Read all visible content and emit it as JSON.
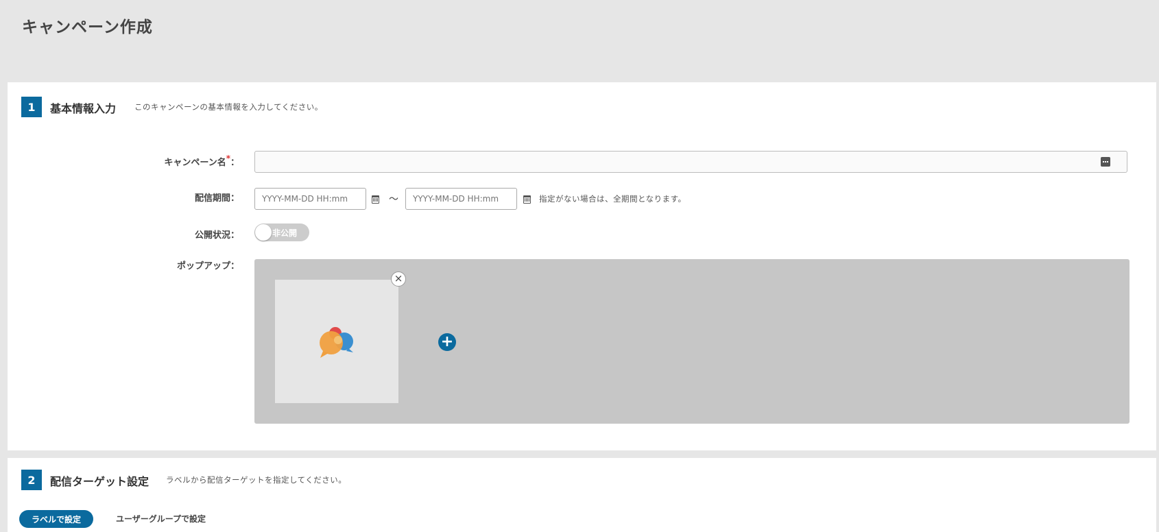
{
  "page": {
    "title": "キャンペーン作成"
  },
  "section1": {
    "number": "1",
    "title": "基本情報入力",
    "description": "このキャンペーンの基本情報を入力してください。",
    "fields": {
      "campaign_name": {
        "label": "キャンペーン名",
        "required_mark": "*",
        "colon": "：",
        "value": ""
      },
      "period": {
        "label": "配信期間：",
        "start_placeholder": "YYYY-MM-DD HH:mm",
        "end_placeholder": "YYYY-MM-DD HH:mm",
        "separator": "〜",
        "hint": "指定がない場合は、全期間となります。"
      },
      "status": {
        "label": "公開状況：",
        "toggle_text": "非公開",
        "enabled": false
      },
      "popup": {
        "label": "ポップアップ："
      }
    },
    "icons": {
      "name_input": "keyboard-icon",
      "start_date": "calendar-icon",
      "end_date": "calendar-icon",
      "popup_close": "close-icon",
      "popup_add": "plus-icon"
    }
  },
  "section2": {
    "number": "2",
    "title": "配信ターゲット設定",
    "description": "ラベルから配信ターゲットを指定してください。",
    "tabs": [
      {
        "label": "ラベルで設定",
        "active": true
      },
      {
        "label": "ユーザーグループで設定",
        "active": false
      }
    ]
  },
  "colors": {
    "accent": "#0b6a9e",
    "background": "#e6e6e6",
    "popup_area": "#c6c6c6",
    "toggle_off": "#cccccc",
    "logo_orange": "#f0a040",
    "logo_red": "#e04a4a",
    "logo_blue": "#3a8fd0"
  }
}
